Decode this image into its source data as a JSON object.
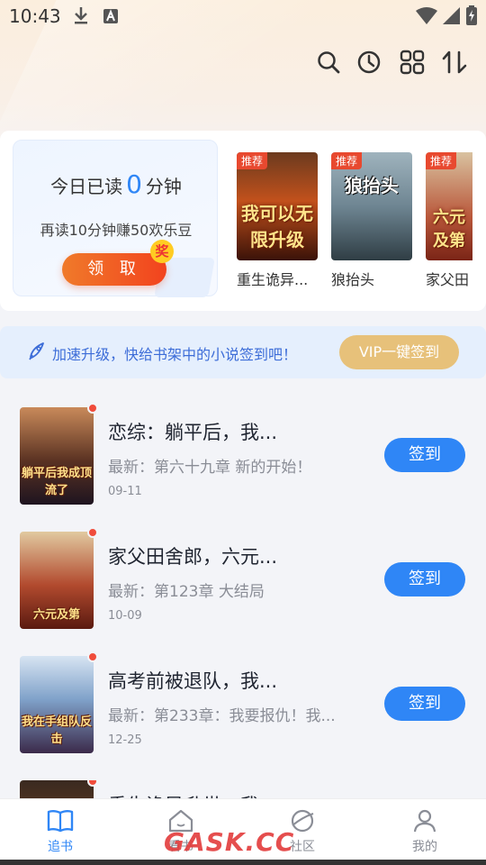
{
  "status_bar": {
    "time": "10:43"
  },
  "toolbar": {
    "icons": [
      "search-icon",
      "history-clock-icon",
      "grid-icon",
      "sort-icon"
    ]
  },
  "reading_card": {
    "title_prefix": "今日已读",
    "minutes": "0",
    "title_suffix": "分钟",
    "subtitle": "再读10分钟赚50欢乐豆",
    "claim_label": "领 取",
    "badge": "奖"
  },
  "recommended": [
    {
      "tag": "推荐",
      "name": "重生诡异...",
      "cover_text": "我可以无限升级"
    },
    {
      "tag": "推荐",
      "name": "狼抬头",
      "cover_text": "狼抬头"
    },
    {
      "tag": "推荐",
      "name": "家父田",
      "cover_text": "六元及第"
    }
  ],
  "promo": {
    "text": "加速升级，快给书架中的小说签到吧！",
    "vip_label": "VIP一键签到"
  },
  "shelf": [
    {
      "title": "恋综：躺平后，我...",
      "latest": "最新：第六十九章 新的开始！",
      "date": "09-11",
      "sign_label": "签到",
      "cover_text": "躺平后我成顶流了"
    },
    {
      "title": "家父田舍郎，六元...",
      "latest": "最新：第123章 大结局",
      "date": "10-09",
      "sign_label": "签到",
      "cover_text": "六元及第"
    },
    {
      "title": "高考前被退队，我...",
      "latest": "最新：第233章：我要报仇！我...",
      "date": "12-25",
      "sign_label": "签到",
      "cover_text": "我在手组队反击"
    },
    {
      "title": "重生诡异升世，我...",
      "latest": "",
      "date": "",
      "sign_label": "",
      "cover_text": ""
    }
  ],
  "bottom_nav": [
    {
      "label": "追书",
      "icon": "book-icon",
      "active": true
    },
    {
      "label": "看书",
      "icon": "home-icon",
      "active": false
    },
    {
      "label": "社区",
      "icon": "planet-icon",
      "active": false
    },
    {
      "label": "我的",
      "icon": "user-icon",
      "active": false
    }
  ],
  "watermark": "GASK.CC",
  "colors": {
    "accent": "#2f86f6",
    "orange": "#f2431e",
    "gold": "#e7c17a"
  }
}
